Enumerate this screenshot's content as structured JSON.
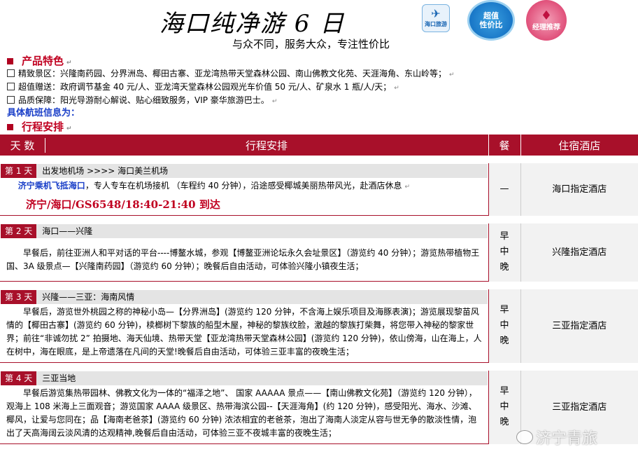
{
  "header": {
    "title": "海口纯净游 6 日",
    "subtitle": "与众不同，服务大众，专注性价比",
    "badges": {
      "brand": "海口旅游",
      "value": "超值\n性价比",
      "manager": "经理推荐"
    }
  },
  "features": {
    "heading": "产品特色",
    "items": [
      "精致景区：兴隆南药园、分界洲岛、椰田古寨、亚龙湾热带天堂森林公园、南山佛教文化苑、天涯海角、东山岭等；",
      "超值赠送：政府调节基金 40 元/人、亚龙湾天堂森林公园观光车价值 50 元/人、矿泉水 1 瓶/人/天；",
      "品质保障：阳光导游耐心解说、贴心细致服务，VIP 豪华旅游巴士。"
    ],
    "flight_info": "具体航班信息为："
  },
  "itinerary": {
    "heading": "行程安排",
    "columns": {
      "day": "天 数",
      "schedule": "行程安排",
      "meal": "餐",
      "hotel": "住宿酒店"
    },
    "days": [
      {
        "label": "第 1 天",
        "title": "出发地机场 >>>> 海口美兰机场",
        "desc_lead": "济宁乘机飞抵海口",
        "desc": "，专人专车在机场接机 （车程约 40 分钟），沿途感受椰城美丽热带风光，赴酒店休息",
        "flight": "济宁/海口/GS6548/18:40-21:40 到达",
        "meal": "—",
        "hotel": "海口指定酒店"
      },
      {
        "label": "第 2 天",
        "title": "海口——兴隆",
        "desc": "早餐后，前往亚洲人和平对话的平台----博鳌水城，参观【博鳌亚洲论坛永久会址景区】（游览约 40 分钟）；游览热带植物王国、3A 级景点—【兴隆南药园】（游览约 60 分钟）；晚餐后自由活动，可体验兴隆小镇夜生活；",
        "meal": "早\n中\n晚",
        "hotel": "兴隆指定酒店"
      },
      {
        "label": "第 3 天",
        "title": "兴隆——三亚：海南风情",
        "desc": "早餐后，游览世外桃园之称的神秘小岛—【分界洲岛】(游览约 120 分钟，不含海上娱乐项目及海豚表演)；游览展现黎苗风情的【椰田古寨】(游览约 60 分钟)，椟榔树下黎族的船型木屋，神秘的黎族纹脸，激越的黎族打柴舞，将您带入神秘的黎家世界；前往“非诚勿扰 2” 拍摄地、海天仙境、热带天堂【亚龙湾热带天堂森林公园】(游览约 120 分钟)，依山傍海，山在海上，人在树中，海在眼底，是上帝遗落在凡间的天堂!晚餐后自由活动，可体验三亚丰富的夜晚生活；",
        "meal": "早\n中\n晚",
        "hotel": "三亚指定酒店"
      },
      {
        "label": "第 4 天",
        "title": "三亚当地",
        "desc": "早餐后游览集热带园林、佛教文化为一体的“福泽之地”、 国家 AAAAA 景点——【南山佛教文化苑】（游览约 120 分钟），观海上 108 米海上三面观音；游览国家 AAAA 级景区、热带海滨公园--【天涯海角】(约 120 分钟)，感受阳光、海水、沙滩、椰风，让爱与您同在；品【海南老爸茶】(游览约 60 分钟) 浓浓相宜的老爸茶，泡出了海南人淡定从容与世无争的散淡性情，泡出了天高海阔云淡风清的达观精神,晚餐后自由活动，可体验三亚不夜城丰富的夜晚生活；",
        "meal": "早\n中\n晚",
        "hotel": "三亚指定酒店"
      }
    ]
  },
  "watermark": "济宁青旅",
  "colors": {
    "accent": "#a8102a",
    "flight": "#c00020",
    "highlight_blue": "#1a3fc8"
  }
}
